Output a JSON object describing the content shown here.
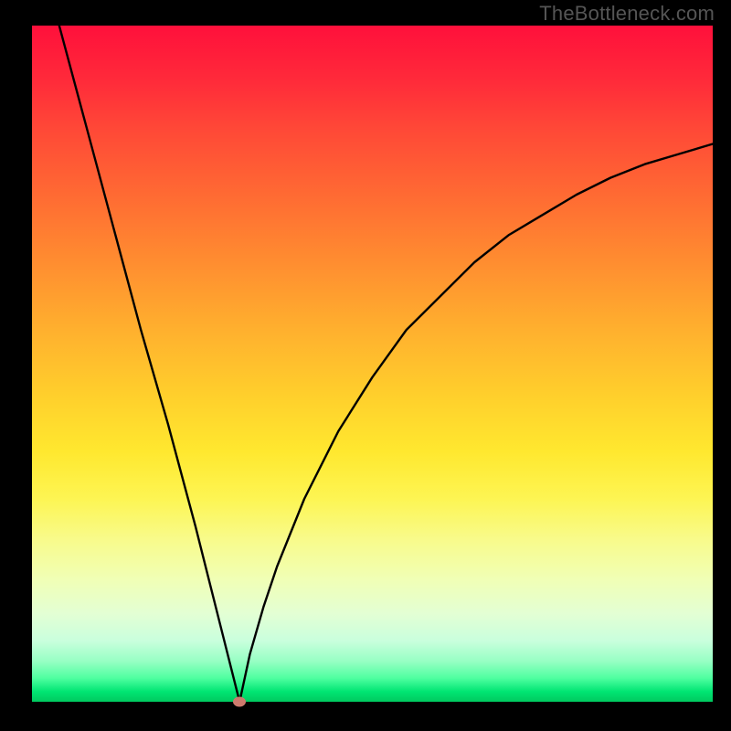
{
  "watermark": "TheBottleneck.com",
  "chart_data": {
    "type": "line",
    "title": "",
    "xlabel": "",
    "ylabel": "",
    "xlim": [
      0,
      100
    ],
    "ylim": [
      0,
      100
    ],
    "minimum_point": {
      "x": 30.5,
      "y": 0
    },
    "series": [
      {
        "name": "bottleneck-curve",
        "x": [
          4,
          8,
          12,
          16,
          20,
          24,
          28,
          30.5,
          32,
          34,
          36,
          40,
          45,
          50,
          55,
          60,
          65,
          70,
          75,
          80,
          85,
          90,
          95,
          100
        ],
        "values": [
          100,
          85,
          70,
          55,
          41,
          26,
          10,
          0,
          7,
          14,
          20,
          30,
          40,
          48,
          55,
          60,
          65,
          69,
          72,
          75,
          77.5,
          79.5,
          81,
          82.5
        ]
      }
    ],
    "marker": {
      "x": 30.5,
      "y": 0,
      "color": "#cd7a6d"
    },
    "background_gradient": {
      "top": "#ff103b",
      "mid": "#ffe82f",
      "bottom": "#00c95f"
    }
  }
}
